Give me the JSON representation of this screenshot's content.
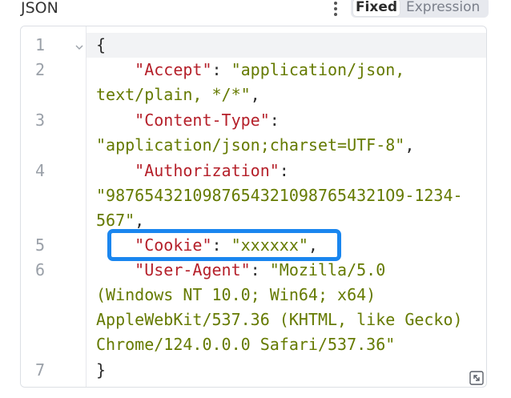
{
  "header": {
    "field_label": "JSON",
    "mode_toggle": {
      "options": [
        "Fixed",
        "Expression"
      ],
      "selected": "Fixed"
    }
  },
  "editor": {
    "language": "json",
    "line_numbers": [
      "1",
      "2",
      "3",
      "4",
      "5",
      "6",
      "7"
    ],
    "lines": [
      "{",
      "    \"Accept\": \"application/json,",
      "text/plain, */*\",",
      "    \"Content-Type\":",
      "\"application/json;charset=UTF-8\",",
      "    \"Authorization\":",
      "\"98765432109876543210987654321O9-1234-",
      "567\",",
      "    \"Cookie\": \"xxxxxx\",",
      "    \"User-Agent\": \"Mozilla/5.0",
      "(Windows NT 10.0; Win64; x64)",
      "AppleWebKit/537.36 (KHTML, like Gecko)",
      "Chrome/124.0.0.0 Safari/537.36\"",
      "}"
    ],
    "tokens": {
      "open_brace": "{",
      "close_brace": "}",
      "k_accept": "\"Accept\"",
      "v_accept_1": "\"application/json,",
      "v_accept_2": "text/plain, */*\"",
      "k_content_type": "\"Content-Type\"",
      "v_content_type": "\"application/json;charset=UTF-8\"",
      "k_authorization": "\"Authorization\"",
      "v_authorization_1": "\"98765432109876543210987654321O9-1234-",
      "v_authorization_2": "567\"",
      "k_cookie": "\"Cookie\"",
      "v_cookie": "\"xxxxxx\"",
      "k_user_agent": "\"User-Agent\"",
      "v_user_agent_1": "\"Mozilla/5.0",
      "v_user_agent_2": "(Windows NT 10.0; Win64; x64)",
      "v_user_agent_3": "AppleWebKit/537.36 (KHTML, like Gecko)",
      "v_user_agent_4": "Chrome/124.0.0.0 Safari/537.36\"",
      "colon": ":",
      "colon_sp": ": ",
      "comma": ","
    },
    "highlighted_entry": "Cookie",
    "highlight_color": "#1a86ef",
    "key_color": "#b5202a",
    "string_color": "#657a00"
  },
  "icons": {
    "menu": "vertical-dots-icon",
    "fold": "chevron-down-icon",
    "resize": "expand-diagonal-icon"
  }
}
